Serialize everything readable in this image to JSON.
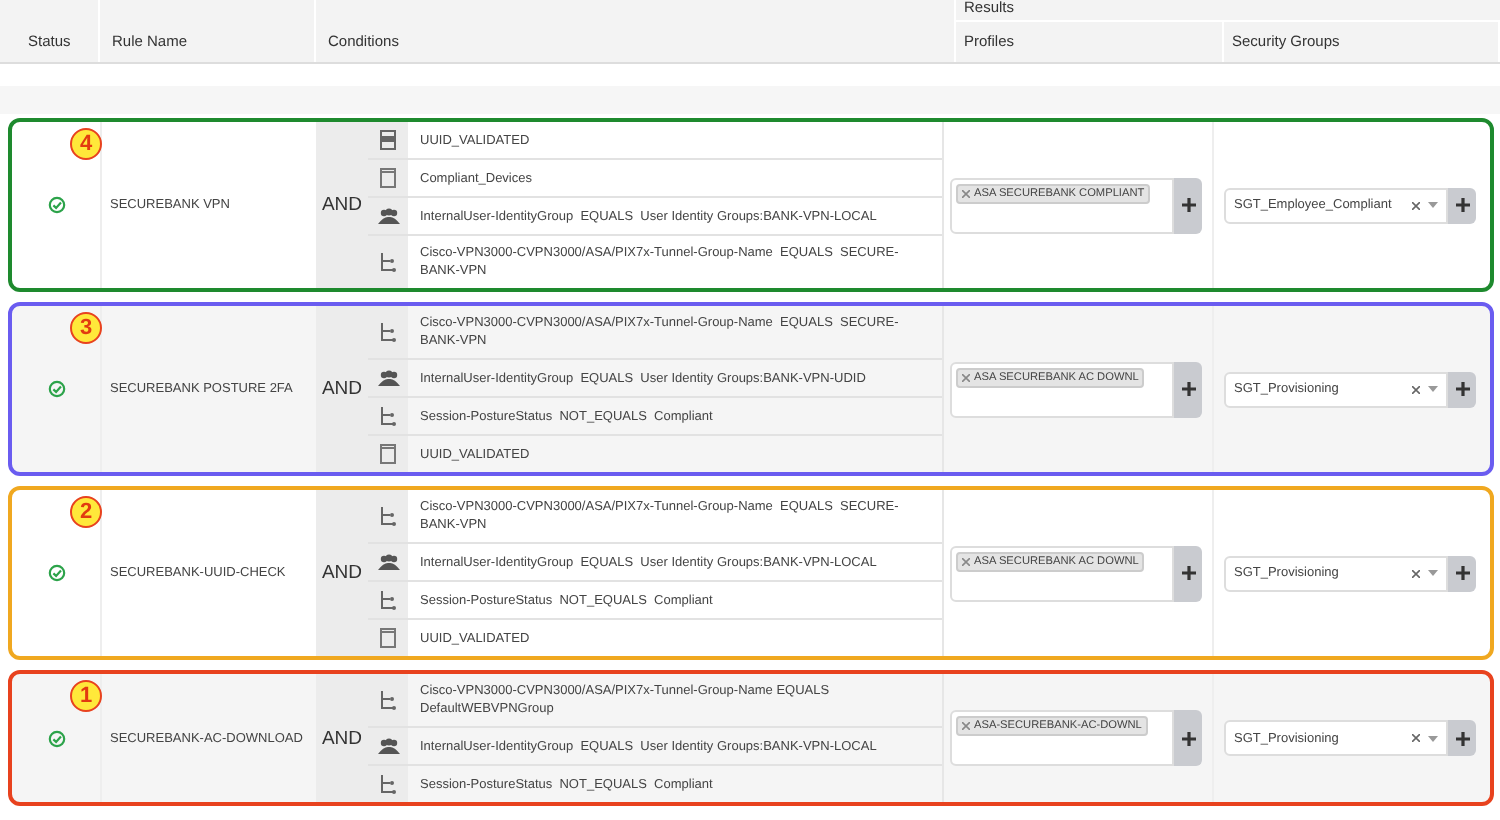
{
  "header": {
    "status": "Status",
    "rule_name": "Rule Name",
    "conditions": "Conditions",
    "results": "Results",
    "profiles": "Profiles",
    "security_groups": "Security Groups"
  },
  "rules": [
    {
      "badge": "4",
      "color": "#1e8a2e",
      "name": "SECUREBANK VPN",
      "operator": "AND",
      "profile": "ASA SECUREBANK COMPLIANT",
      "security_group": "SGT_Employee_Compliant",
      "conditions": [
        {
          "kind": "library-filled",
          "text": "UUID_VALIDATED"
        },
        {
          "kind": "library",
          "text": "Compliant_Devices"
        },
        {
          "kind": "group",
          "text": "InternalUser-IdentityGroup  EQUALS  User Identity Groups:BANK-VPN-LOCAL"
        },
        {
          "kind": "attribute",
          "text": "Cisco-VPN3000-CVPN3000/ASA/PIX7x-Tunnel-Group-Name  EQUALS  SECURE-BANK-VPN"
        }
      ]
    },
    {
      "badge": "3",
      "color": "#6a5cf0",
      "name": "SECUREBANK POSTURE 2FA",
      "operator": "AND",
      "profile": "ASA SECUREBANK AC DOWNL",
      "security_group": "SGT_Provisioning",
      "conditions": [
        {
          "kind": "attribute",
          "text": "Cisco-VPN3000-CVPN3000/ASA/PIX7x-Tunnel-Group-Name  EQUALS  SECURE-BANK-VPN"
        },
        {
          "kind": "group",
          "text": "InternalUser-IdentityGroup  EQUALS  User Identity Groups:BANK-VPN-UDID"
        },
        {
          "kind": "attribute",
          "text": "Session-PostureStatus  NOT_EQUALS  Compliant"
        },
        {
          "kind": "library",
          "text": "UUID_VALIDATED"
        }
      ]
    },
    {
      "badge": "2",
      "color": "#f0a820",
      "name": "SECUREBANK-UUID-CHECK",
      "operator": "AND",
      "profile": "ASA SECUREBANK AC DOWNL",
      "security_group": "SGT_Provisioning",
      "conditions": [
        {
          "kind": "attribute",
          "text": "Cisco-VPN3000-CVPN3000/ASA/PIX7x-Tunnel-Group-Name  EQUALS  SECURE-BANK-VPN"
        },
        {
          "kind": "group",
          "text": "InternalUser-IdentityGroup  EQUALS  User Identity Groups:BANK-VPN-LOCAL"
        },
        {
          "kind": "attribute",
          "text": "Session-PostureStatus  NOT_EQUALS  Compliant"
        },
        {
          "kind": "library",
          "text": "UUID_VALIDATED"
        }
      ]
    },
    {
      "badge": "1",
      "color": "#e8421e",
      "name": "SECUREBANK-AC-DOWNLOAD",
      "operator": "AND",
      "profile": "ASA-SECUREBANK-AC-DOWNL",
      "security_group": "SGT_Provisioning",
      "conditions": [
        {
          "kind": "attribute",
          "text": "Cisco-VPN3000-CVPN3000/ASA/PIX7x-Tunnel-Group-Name EQUALS DefaultWEBVPNGroup"
        },
        {
          "kind": "group",
          "text": "InternalUser-IdentityGroup  EQUALS  User Identity Groups:BANK-VPN-LOCAL"
        },
        {
          "kind": "attribute",
          "text": "Session-PostureStatus  NOT_EQUALS  Compliant"
        }
      ]
    }
  ]
}
